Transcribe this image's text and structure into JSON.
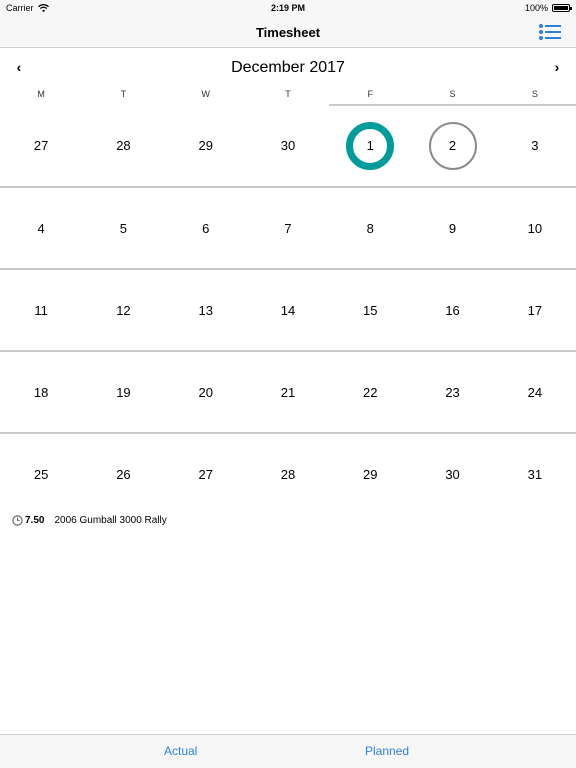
{
  "status_bar": {
    "carrier": "Carrier",
    "time": "2:19 PM",
    "battery": "100%",
    "battery_level": 1.0
  },
  "nav": {
    "title": "Timesheet",
    "list_icon": "list-icon"
  },
  "calendar": {
    "month_label": "December 2017",
    "prev_label": "‹",
    "next_label": "›",
    "weekdays": [
      "M",
      "T",
      "W",
      "T",
      "F",
      "S",
      "S"
    ],
    "weeks": [
      [
        "27",
        "28",
        "29",
        "30",
        "1",
        "2",
        "3"
      ],
      [
        "4",
        "5",
        "6",
        "7",
        "8",
        "9",
        "10"
      ],
      [
        "11",
        "12",
        "13",
        "14",
        "15",
        "16",
        "17"
      ],
      [
        "18",
        "19",
        "20",
        "21",
        "22",
        "23",
        "24"
      ],
      [
        "25",
        "26",
        "27",
        "28",
        "29",
        "30",
        "31"
      ]
    ],
    "today": "1",
    "selected": "2"
  },
  "entries": [
    {
      "icon": "clock-icon",
      "hours": "7.50",
      "project": "2006 Gumball 3000 Rally"
    }
  ],
  "tabs": {
    "actual": "Actual",
    "planned": "Planned"
  },
  "colors": {
    "today_ring": "#009c9c",
    "selected_ring": "#8a8a8a",
    "tab_text": "#2f7fe0",
    "list_icon": "#2f7fe0"
  }
}
